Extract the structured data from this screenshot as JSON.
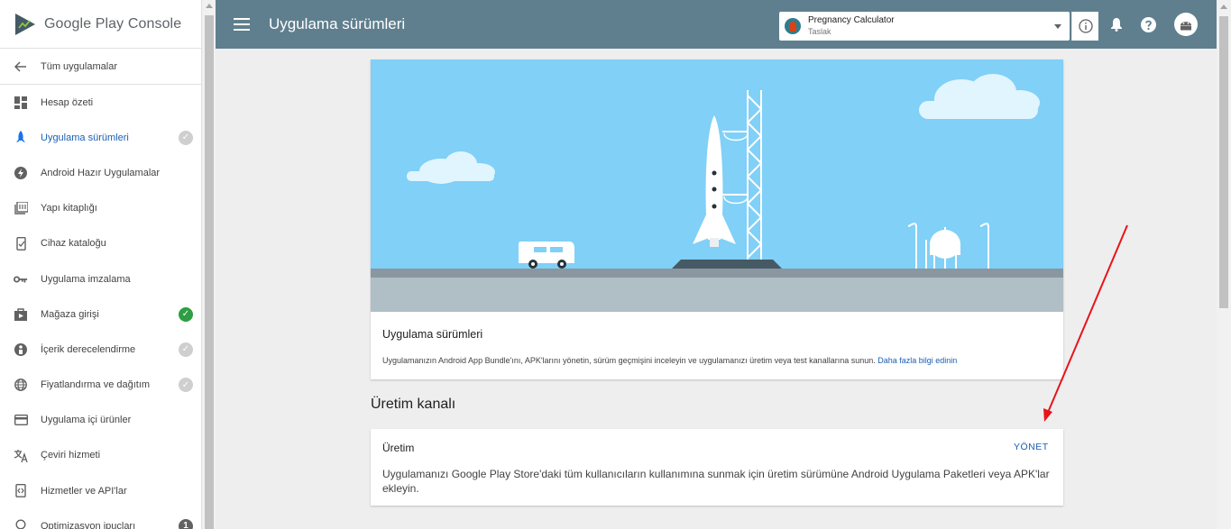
{
  "sidebar": {
    "brand": "Google Play",
    "brand_sub": "Console",
    "back_label": "Tüm uygulamalar",
    "items": [
      {
        "label": "Hesap özeti",
        "icon": "dashboard-icon"
      },
      {
        "label": "Uygulama sürümleri",
        "icon": "rocket-icon",
        "active": true,
        "status": "grey"
      },
      {
        "label": "Android Hazır Uygulamalar",
        "icon": "bolt-icon"
      },
      {
        "label": "Yapı kitaplığı",
        "icon": "library-icon"
      },
      {
        "label": "Cihaz kataloğu",
        "icon": "device-catalog-icon"
      },
      {
        "label": "Uygulama imzalama",
        "icon": "key-icon"
      },
      {
        "label": "Mağaza girişi",
        "icon": "store-listing-icon",
        "status": "green"
      },
      {
        "label": "İçerik derecelendirme",
        "icon": "content-rating-icon",
        "status": "grey"
      },
      {
        "label": "Fiyatlandırma ve dağıtım",
        "icon": "globe-icon",
        "status": "grey"
      },
      {
        "label": "Uygulama içi ürünler",
        "icon": "card-icon"
      },
      {
        "label": "Çeviri hizmeti",
        "icon": "translate-icon"
      },
      {
        "label": "Hizmetler ve API'lar",
        "icon": "api-icon"
      },
      {
        "label": "Optimizasyon ipuçları",
        "icon": "bulb-icon",
        "badge": "1"
      }
    ]
  },
  "header": {
    "title": "Uygulama sürümleri",
    "app_selector": {
      "name": "Pregnancy Calculator",
      "status": "Taslak"
    }
  },
  "hero": {
    "title": "Uygulama sürümleri",
    "description": "Uygulamanızın Android App Bundle'ını, APK'larını yönetin, sürüm geçmişini inceleyin ve uygulamanızı üretim veya test kanallarına sunun.",
    "link": "Daha fazla bilgi edinin"
  },
  "production_section": {
    "title": "Üretim kanalı",
    "card_title": "Üretim",
    "manage_label": "YÖNET",
    "description": "Uygulamanızı Google Play Store'daki tüm kullanıcıların kullanımına sunmak için üretim sürümüne Android Uygulama Paketleri veya APK'lar ekleyin."
  },
  "colors": {
    "header_bg": "#5f7f8e",
    "accent_link": "#1a5fb4",
    "status_green": "#2e9e44",
    "status_grey": "#cfcfcf",
    "annotation_arrow": "#e8141a",
    "sky": "#80d0f7"
  }
}
